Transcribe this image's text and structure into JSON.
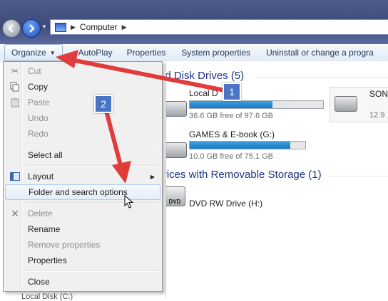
{
  "address": {
    "path": "Computer"
  },
  "toolbar": {
    "organize": "Organize",
    "autoplay": "AutoPlay",
    "properties": "Properties",
    "system_properties": "System properties",
    "uninstall": "Uninstall or change a progra"
  },
  "groups": {
    "hdd_title": "ard Disk Drives (5)",
    "removable_title": "evices with Removable Storage (1)"
  },
  "drives": [
    {
      "name": "Local D",
      "free": "36.6 GB free of 97.6 GB",
      "used_fraction": 0.62
    },
    {
      "name": "GAMES & E-book (G:)",
      "free": "10.0 GB free of 75.1 GB",
      "used_fraction": 0.87
    },
    {
      "name": "SON",
      "free": "12.9"
    }
  ],
  "dvd": {
    "name": "DVD RW Drive (H:)",
    "label": "DVD"
  },
  "menu": {
    "cut": "Cut",
    "copy": "Copy",
    "paste": "Paste",
    "undo": "Undo",
    "redo": "Redo",
    "select_all": "Select all",
    "layout": "Layout",
    "folder_options": "Folder and search options",
    "delete": "Delete",
    "rename": "Rename",
    "remove_properties": "Remove properties",
    "properties": "Properties",
    "close": "Close"
  },
  "annotations": {
    "badge1": "1",
    "badge2": "2",
    "arrow_color": "#e03c3c"
  },
  "navpane": {
    "bottom_item": "Local Disk (C:)"
  }
}
